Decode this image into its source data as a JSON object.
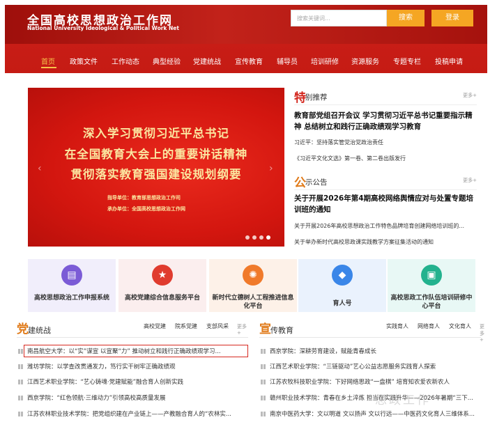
{
  "header": {
    "logo_cn": "全国高校思想政治工作网",
    "logo_en": "National University Ideological & Political Work Net",
    "search_placeholder": "搜索关键词...",
    "search_btn": "搜索",
    "login_btn": "登录"
  },
  "nav": [
    "首页",
    "政策文件",
    "工作动态",
    "典型经验",
    "党建统战",
    "宣传教育",
    "辅导员",
    "培训研修",
    "资源服务",
    "专题专栏",
    "投稿申请"
  ],
  "banner": {
    "line1": "深入学习贯彻习近平总书记",
    "line2": "在全国教育大会上的重要讲话精神",
    "line3": "贯彻落实教育强国建设规划纲要",
    "guide": "指导单位：教育部思想政治工作司",
    "host": "承办单位：全国高校思想政治工作网"
  },
  "featured": {
    "mark": "特",
    "title": "别推荐",
    "more": "更多+",
    "headline": "教育部党组召开会议 学习贯彻习近平总书记重要指示精神 总结树立和践行正确政绩观学习教育",
    "links": [
      "习近平：坚持落实管党治党政治责任",
      "《习近平文化文选》第一卷、第二卷出版发行"
    ]
  },
  "notice": {
    "mark": "公",
    "title": "示公告",
    "more": "更多+",
    "headline": "关于开展2026年第4期高校网络舆情应对与处置专题培训班的通知",
    "links": [
      "关于开展2026年高校思想政治工作特色品牌培育创建网络培训班的...",
      "关于举办新时代高校思政课实践教学方案征集活动的通知"
    ]
  },
  "services": [
    {
      "label": "高校思想政治工作申报系统",
      "icon": "document-icon",
      "bg": "#f1eefb",
      "iconbg": "#7b5bd6",
      "glyph": "▤"
    },
    {
      "label": "高校党建综合信息服务平台",
      "icon": "party-emblem-icon",
      "bg": "#fbeeee",
      "iconbg": "#e03b2e",
      "glyph": "★"
    },
    {
      "label": "新时代立德树人工程推进信息化平台",
      "icon": "lightbulb-icon",
      "bg": "#fdf1e8",
      "iconbg": "#f07a2a",
      "glyph": "✺"
    },
    {
      "label": "育人号",
      "icon": "graduate-icon",
      "bg": "#eaf2fd",
      "iconbg": "#3a86e8",
      "glyph": "◆"
    },
    {
      "label": "高校思政工作队伍培训研修中心平台",
      "icon": "monitor-icon",
      "bg": "#e8f8f5",
      "iconbg": "#23b28e",
      "glyph": "▣"
    }
  ],
  "party": {
    "mark": "党",
    "title": "建统战",
    "tabs": [
      "高校党建",
      "院系党建",
      "支部风采"
    ],
    "more": "更多+",
    "items": [
      "南昌航空大学：以“实”谋宣 以宣聚“力” 推动树立和践行正确政绩观学习...",
      "潍坊学院：以学查改贯通发力，笃行实干树牢正确政绩观",
      "江西艺术职业学院：“艺心铸魂·党建赋能”融合育人创新实践",
      "西京学院：“红色领航·三维动力”引领高校高质量发展",
      "江苏农林职业技术学院：把党组织建在产业链上——产教融合育人的“农林实..."
    ]
  },
  "publicity": {
    "mark": "宣",
    "title": "传教育",
    "tabs": [
      "实践育人",
      "网络育人",
      "文化育人"
    ],
    "more": "更多+",
    "items": [
      "西京学院：深耕劳育建设，赋能青春成长",
      "江西艺术职业学院：“三链驱动”艺心公益志愿服务实践育人探索",
      "江苏农牧科技职业学院：下好网络思政“一盘棋” 培育知农爱农新农人",
      "赣州职业技术学院：青春在乡土淬炼 担当在实践升华——2026年暑期“三下...",
      "南京中医药大学：文以明道 文以扬声 文以行远——中医药文化育人三维体系..."
    ]
  },
  "watermark": "思政工作"
}
